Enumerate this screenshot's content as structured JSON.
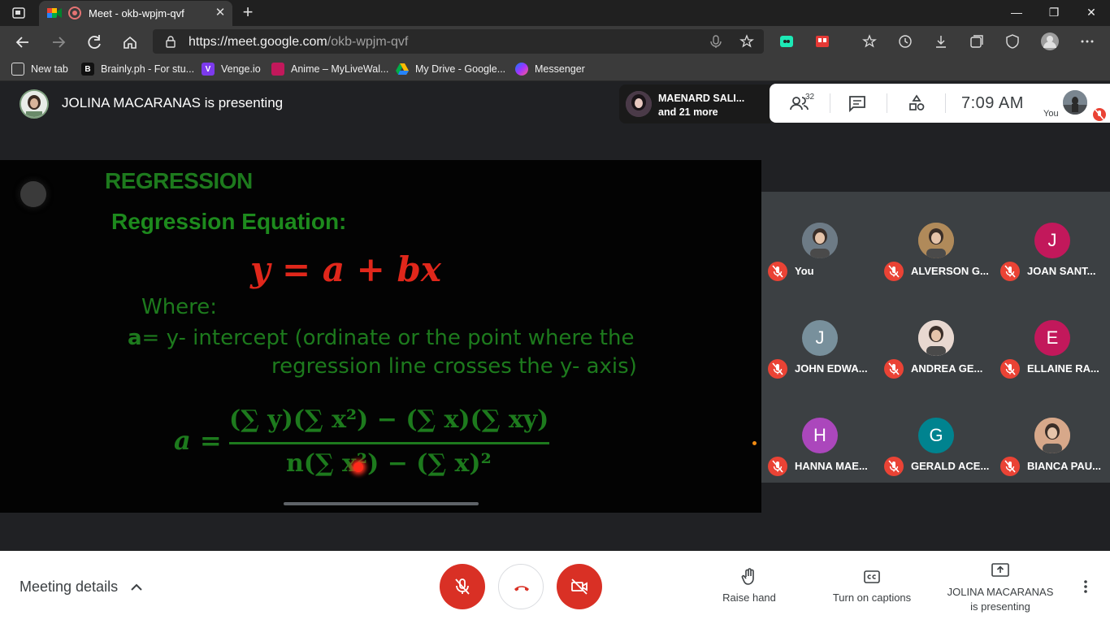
{
  "browser": {
    "tab_title": "Meet - okb-wpjm-qvf",
    "tab_close": "✕",
    "new_tab": "+",
    "window_minimize": "—",
    "window_restore": "❐",
    "window_close": "✕",
    "url_host": "https://meet.google.com",
    "url_path": "/okb-wpjm-qvf",
    "bookmarks": [
      {
        "label": "New tab"
      },
      {
        "label": "Brainly.ph - For stu..."
      },
      {
        "label": "Venge.io"
      },
      {
        "label": "Anime – MyLiveWal..."
      },
      {
        "label": "My Drive - Google..."
      },
      {
        "label": "Messenger"
      }
    ]
  },
  "meet": {
    "presenting_label": "JOLINA MACARANAS is presenting",
    "collaborator": {
      "line1": "MAENARD SALI...",
      "line2": "and 21 more"
    },
    "participant_count": "32",
    "clock": "7:09  AM",
    "you_label": "You",
    "slide": {
      "title": "REGRESSION",
      "subtitle": "Regression Equation:",
      "equation": "y = a + bx",
      "where": "Where:",
      "def_bold": "a",
      "def_rest": "= y- intercept (ordinate or the point where the",
      "def_line2": "regression line crosses the y- axis)",
      "a_lhs": "a =",
      "numerator": "(∑ y)(∑ x²) − (∑ x)(∑ xy)",
      "denominator": "n(∑ x²) − (∑ x)²"
    },
    "participants": [
      {
        "name": "You",
        "initial": "",
        "color": "#6d7b86"
      },
      {
        "name": "ALVERSON G...",
        "initial": "",
        "color": "#b08a5a"
      },
      {
        "name": "JOAN SANT...",
        "initial": "J",
        "color": "#c2185b"
      },
      {
        "name": "JOHN EDWA...",
        "initial": "J",
        "color": "#78909c"
      },
      {
        "name": "ANDREA GE...",
        "initial": "",
        "color": "#e8d8d0"
      },
      {
        "name": "ELLAINE RA...",
        "initial": "E",
        "color": "#c2185b"
      },
      {
        "name": "HANNA MAE...",
        "initial": "H",
        "color": "#ab47bc"
      },
      {
        "name": "GERALD ACE...",
        "initial": "G",
        "color": "#00838f"
      },
      {
        "name": "BIANCA PAU...",
        "initial": "",
        "color": "#d7a88a"
      }
    ],
    "bottom": {
      "meeting_details": "Meeting details",
      "raise_hand": "Raise hand",
      "captions": "Turn on captions",
      "presenting_line1": "JOLINA MACARANAS",
      "presenting_line2": "is presenting"
    }
  },
  "colors": {
    "accent_red": "#d93025",
    "mute_red": "#ea4335",
    "slide_green": "#1d7a1d",
    "slide_red": "#e0271b"
  }
}
